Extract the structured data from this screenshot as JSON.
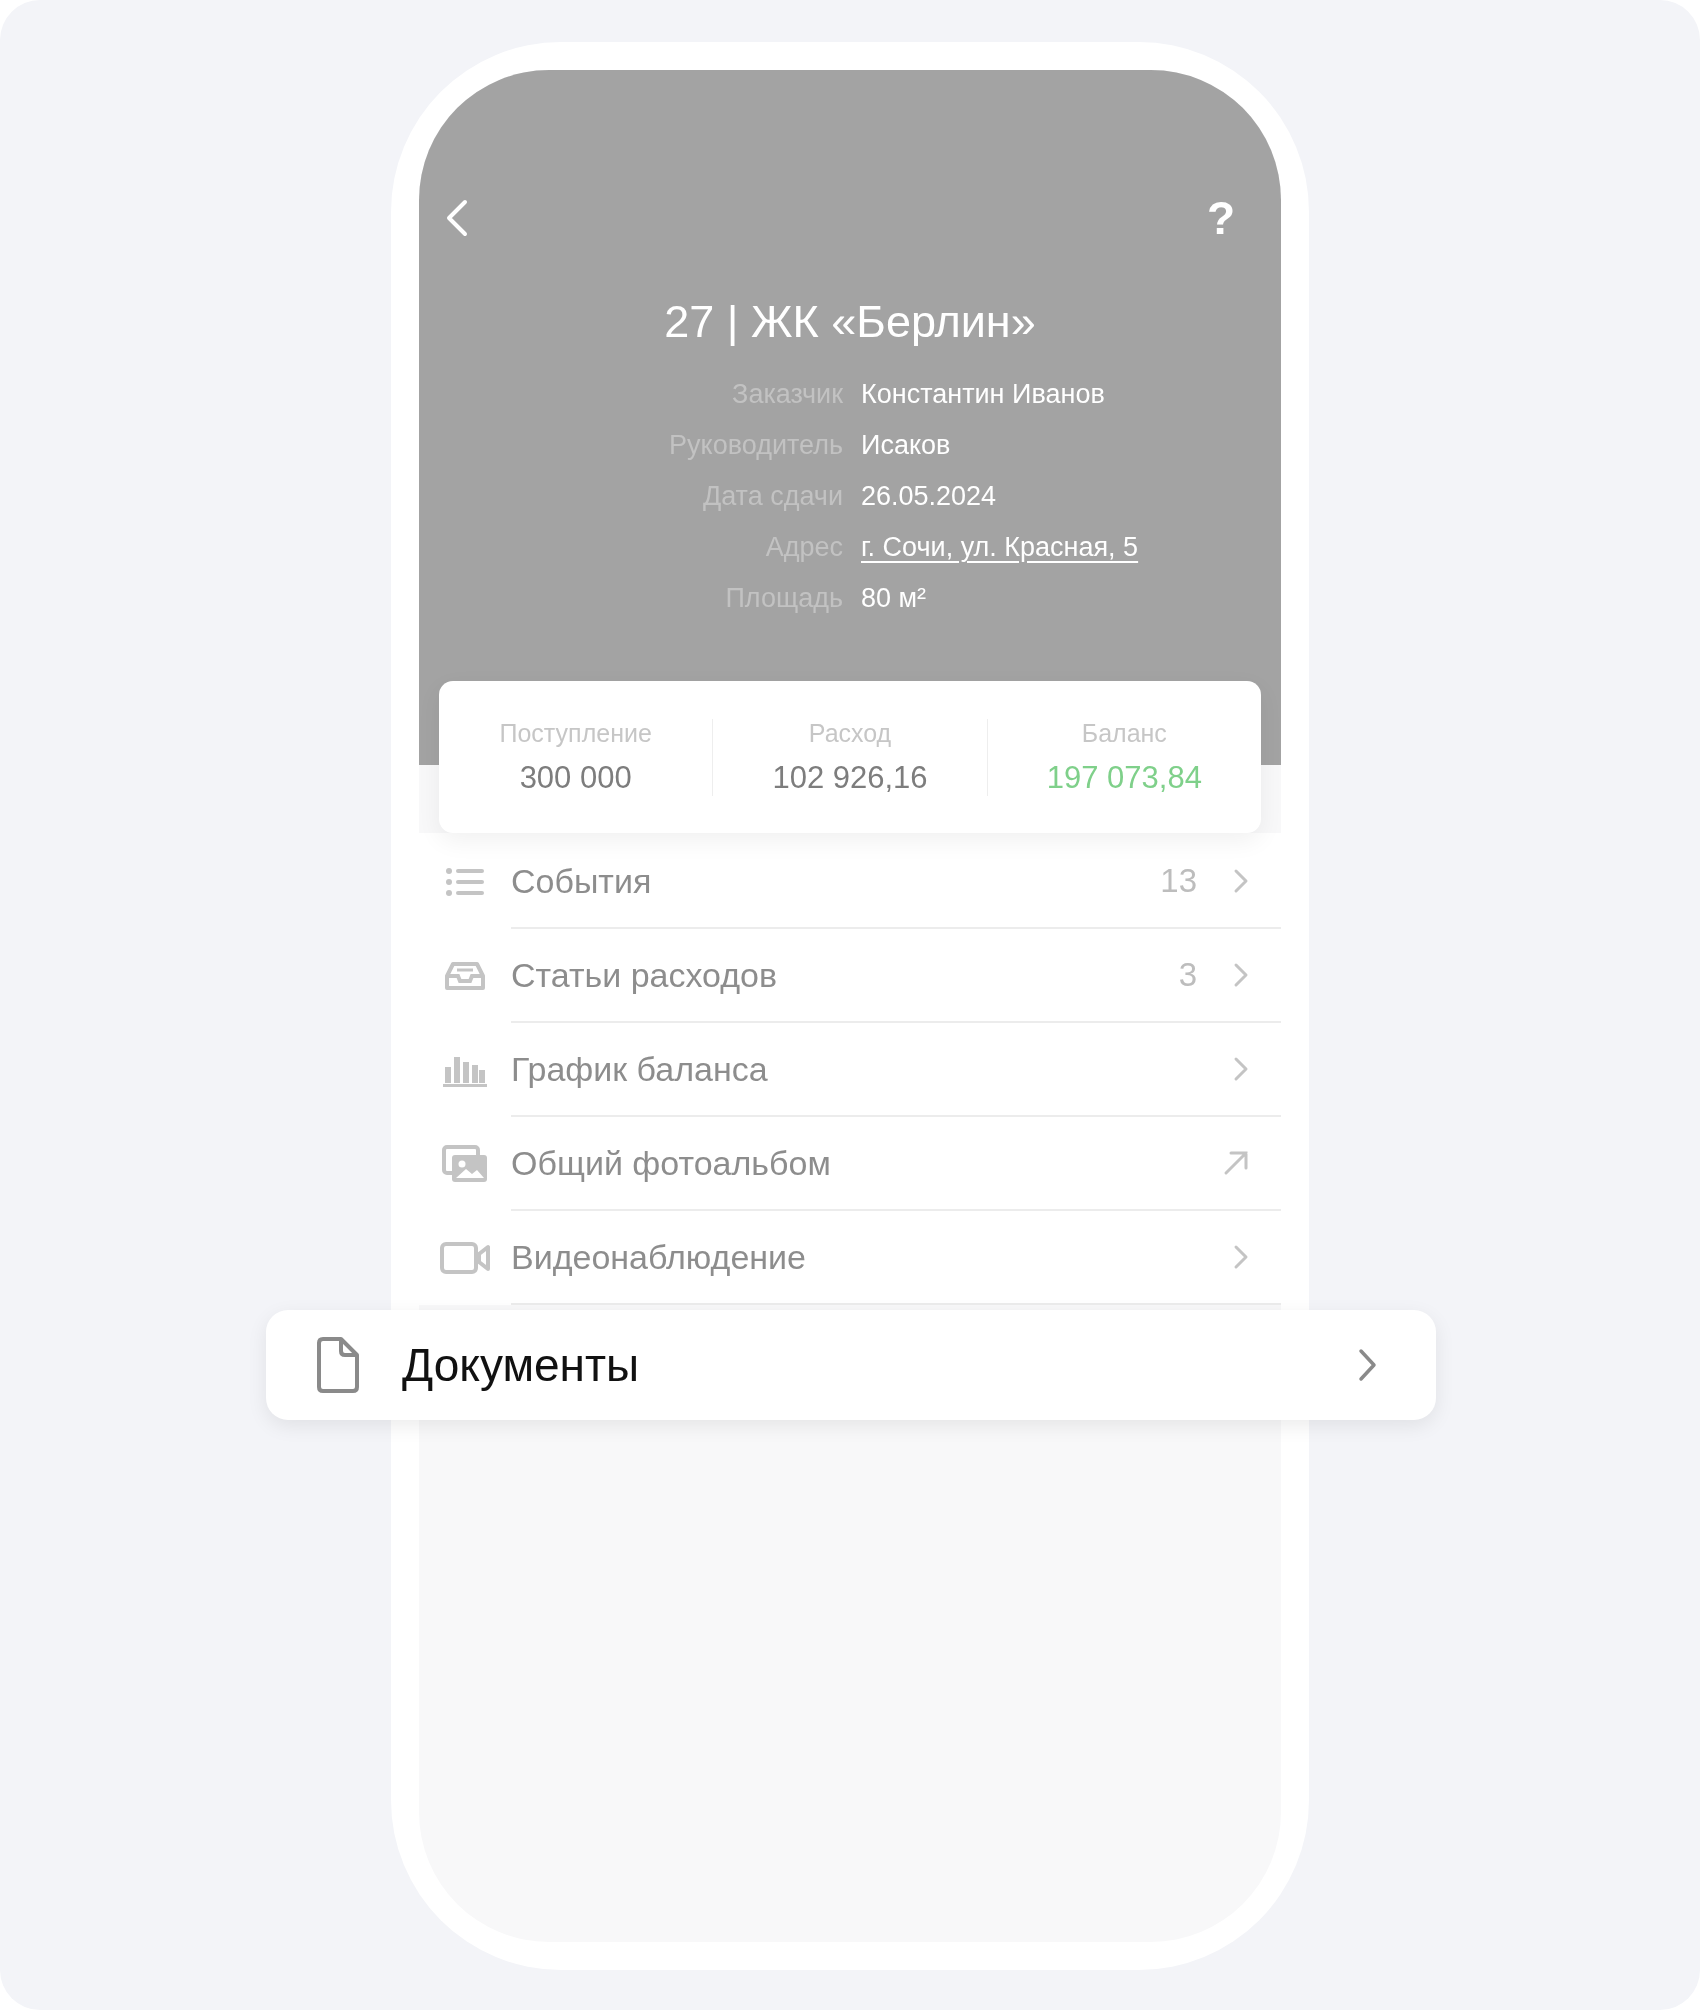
{
  "header": {
    "help": "?",
    "title": "27 | ЖК «Берлин»",
    "details": [
      {
        "label": "Заказчик",
        "value": "Константин Иванов",
        "kind": "text"
      },
      {
        "label": "Руководитель",
        "value": "Исаков",
        "kind": "text"
      },
      {
        "label": "Дата сдачи",
        "value": "26.05.2024",
        "kind": "text"
      },
      {
        "label": "Адрес",
        "value": "г. Сочи, ул. Красная, 5",
        "kind": "link"
      },
      {
        "label": "Площадь",
        "value": "80 м²",
        "kind": "text"
      }
    ]
  },
  "summary": [
    {
      "label": "Поступление",
      "value": "300 000",
      "kind": "neutral"
    },
    {
      "label": "Расход",
      "value": "102 926,16",
      "kind": "neutral"
    },
    {
      "label": "Баланс",
      "value": "197 073,84",
      "kind": "positive"
    }
  ],
  "menu": [
    {
      "label": "События",
      "count": "13",
      "kind": "nav"
    },
    {
      "label": "Статьи расходов",
      "count": "3",
      "kind": "nav"
    },
    {
      "label": "График баланса",
      "kind": "nav"
    },
    {
      "label": "Общий фотоальбом",
      "kind": "external"
    },
    {
      "label": "Видеонаблюдение",
      "kind": "nav"
    }
  ],
  "highlight": {
    "label": "Документы"
  }
}
